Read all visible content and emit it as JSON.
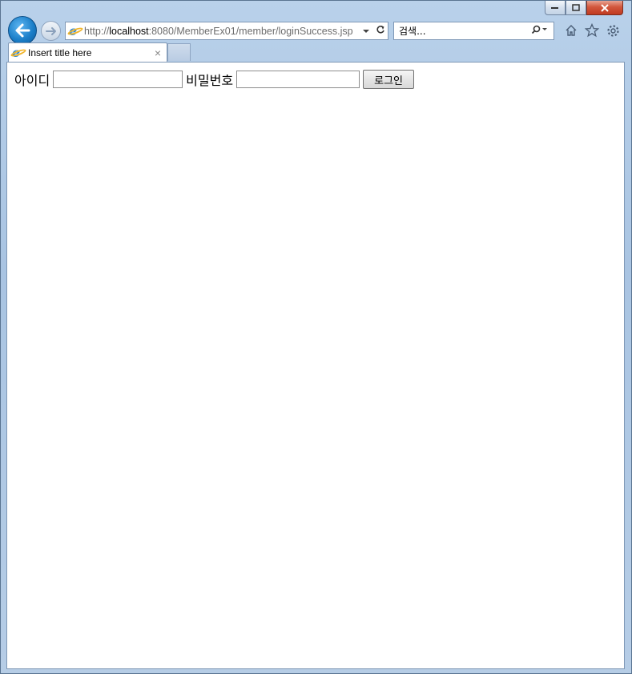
{
  "window": {
    "caption": {
      "minimize_icon": "minimize-icon",
      "maximize_icon": "restore-icon",
      "close_icon": "close-icon"
    }
  },
  "toolbar": {
    "address": {
      "scheme": "http://",
      "host": "localhost",
      "rest": ":8080/MemberEx01/member/loginSuccess.jsp",
      "dropdown_icon": "chevron-down-icon",
      "refresh_icon": "refresh-icon"
    },
    "search": {
      "placeholder": "검색...",
      "icon": "search-icon"
    },
    "tools": [
      "home-icon",
      "favorites-icon",
      "settings-icon"
    ]
  },
  "tab": {
    "title": "Insert title here",
    "close": "×"
  },
  "form": {
    "id_label": "아이디",
    "id_value": "",
    "password_label": "비밀번호",
    "password_value": "",
    "login_button": "로그인"
  },
  "colors": {
    "accent": "#1b7fc9",
    "frame": "#b9d1ea",
    "close_button": "#c03a20"
  }
}
